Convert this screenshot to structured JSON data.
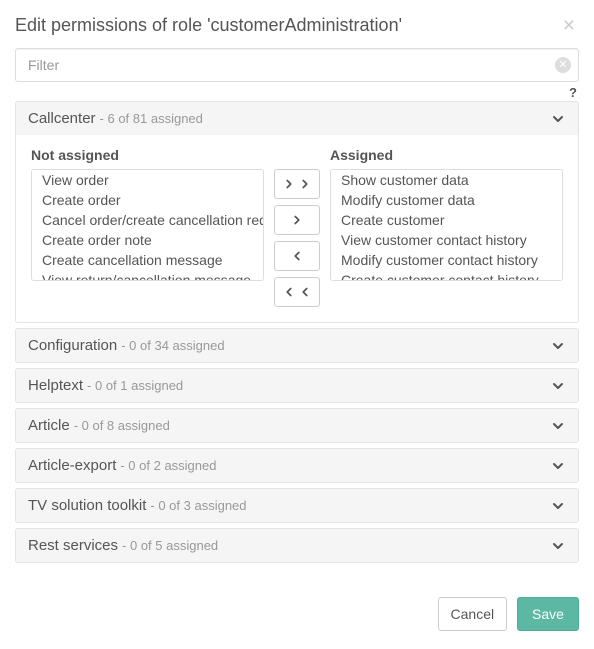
{
  "header": {
    "title": "Edit permissions of role 'customerAdministration'",
    "close_icon": "×"
  },
  "filter": {
    "placeholder": "Filter",
    "value": "",
    "help": "?"
  },
  "sections": [
    {
      "key": "callcenter",
      "title": "Callcenter",
      "info": " - 6 of 81 assigned",
      "expanded": true,
      "left_label": "Not assigned",
      "right_label": "Assigned",
      "left_items": [
        "View order",
        "Create order",
        "Cancel order/create cancellation request",
        "Create order note",
        "Create cancellation message",
        "View return/cancellation message"
      ],
      "right_items": [
        "Show customer data",
        "Modify customer data",
        "Create customer",
        "View customer contact history",
        "Modify customer contact history",
        "Create customer contact history"
      ]
    },
    {
      "key": "configuration",
      "title": "Configuration",
      "info": " - 0 of 34 assigned",
      "expanded": false
    },
    {
      "key": "helptext",
      "title": "Helptext",
      "info": " - 0 of 1 assigned",
      "expanded": false
    },
    {
      "key": "article",
      "title": "Article",
      "info": " - 0 of 8 assigned",
      "expanded": false
    },
    {
      "key": "article-export",
      "title": "Article-export",
      "info": " - 0 of 2 assigned",
      "expanded": false
    },
    {
      "key": "tv-toolkit",
      "title": "TV solution toolkit",
      "info": " - 0 of 3 assigned",
      "expanded": false
    },
    {
      "key": "rest-services",
      "title": "Rest services",
      "info": " - 0 of 5 assigned",
      "expanded": false
    }
  ],
  "footer": {
    "cancel": "Cancel",
    "save": "Save"
  }
}
